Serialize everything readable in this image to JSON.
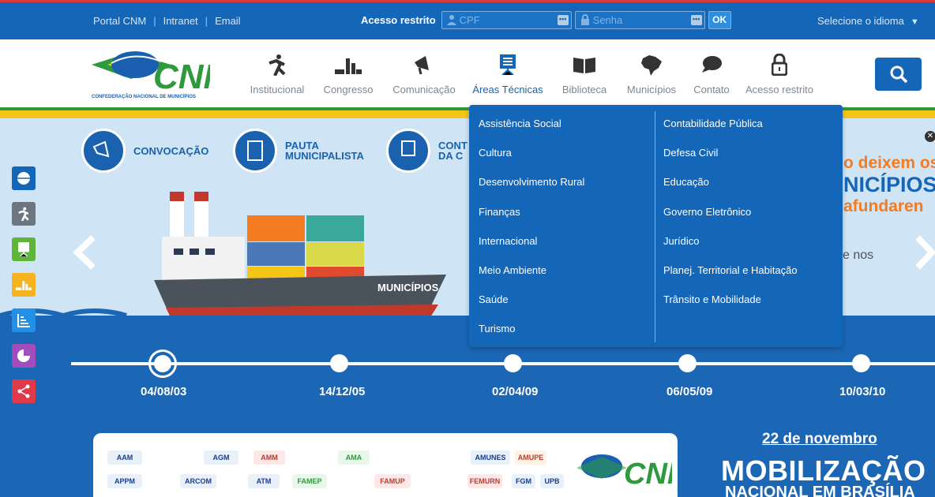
{
  "topbar": {
    "links": [
      "Portal CNM",
      "Intranet",
      "Email"
    ],
    "restricted_label": "Acesso restrito",
    "cpf_placeholder": "CPF",
    "password_placeholder": "Senha",
    "ok_label": "OK",
    "language_label": "Selecione o idioma"
  },
  "logo": {
    "text": "CNM",
    "subtitle": "CONFEDERAÇÃO NACIONAL DE MUNICÍPIOS"
  },
  "nav": {
    "items": [
      {
        "label": "Institucional",
        "icon": "person-running-icon"
      },
      {
        "label": "Congresso",
        "icon": "bar-icon"
      },
      {
        "label": "Comunicação",
        "icon": "megaphone-icon"
      },
      {
        "label": "Áreas Técnicas",
        "icon": "presentation-board-icon",
        "active": true
      },
      {
        "label": "Biblioteca",
        "icon": "book-icon"
      },
      {
        "label": "Municípios",
        "icon": "brazil-map-icon"
      },
      {
        "label": "Contato",
        "icon": "chat-bubble-icon"
      },
      {
        "label": "Acesso restrito",
        "icon": "lock-icon"
      }
    ]
  },
  "dropdown": {
    "col1": [
      "Assistência Social",
      "Cultura",
      "Desenvolvimento Rural",
      "Finanças",
      "Internacional",
      "Meio Ambiente",
      "Saúde",
      "Turismo"
    ],
    "col2": [
      "Contabilidade Pública",
      "Defesa Civil",
      "Educação",
      "Governo Eletrônico",
      "Jurídico",
      "Planej. Territorial e Habitação",
      "Trânsito e Mobilidade"
    ]
  },
  "banner": {
    "categories": [
      {
        "line1": "CONVOCAÇÃO",
        "line2": ""
      },
      {
        "line1": "PAUTA",
        "line2": "MUNICIPALISTA"
      },
      {
        "line1": "CONT",
        "line2": "DA C"
      }
    ],
    "ship_label": "MUNICÍPIOS",
    "right_line1": "o deixem os",
    "right_line2": "NICÍPIOS",
    "right_line3": "afundaren",
    "right_line4": "e nos"
  },
  "timeline": {
    "dates": [
      "04/08/03",
      "14/12/05",
      "02/04/09",
      "06/05/09",
      "10/03/10"
    ]
  },
  "promo": {
    "date": "22 de novembro",
    "title": "MOBILIZAÇÃO",
    "subtitle": "NACIONAL EM BRASÍLIA"
  },
  "partners": {
    "row1": [
      "AAM",
      "AGM",
      "AMM",
      "AMA",
      "AMUNES",
      "AMUPE"
    ],
    "row2": [
      "APPM",
      "ARCOM",
      "ATM",
      "FAMEP",
      "FAMUP",
      "FEMURN",
      "FGM",
      "UPB"
    ]
  },
  "colors": {
    "primary": "#1466b8",
    "accent_green": "#2e9a3d",
    "accent_yellow": "#f5c518",
    "orange": "#f47b20"
  }
}
